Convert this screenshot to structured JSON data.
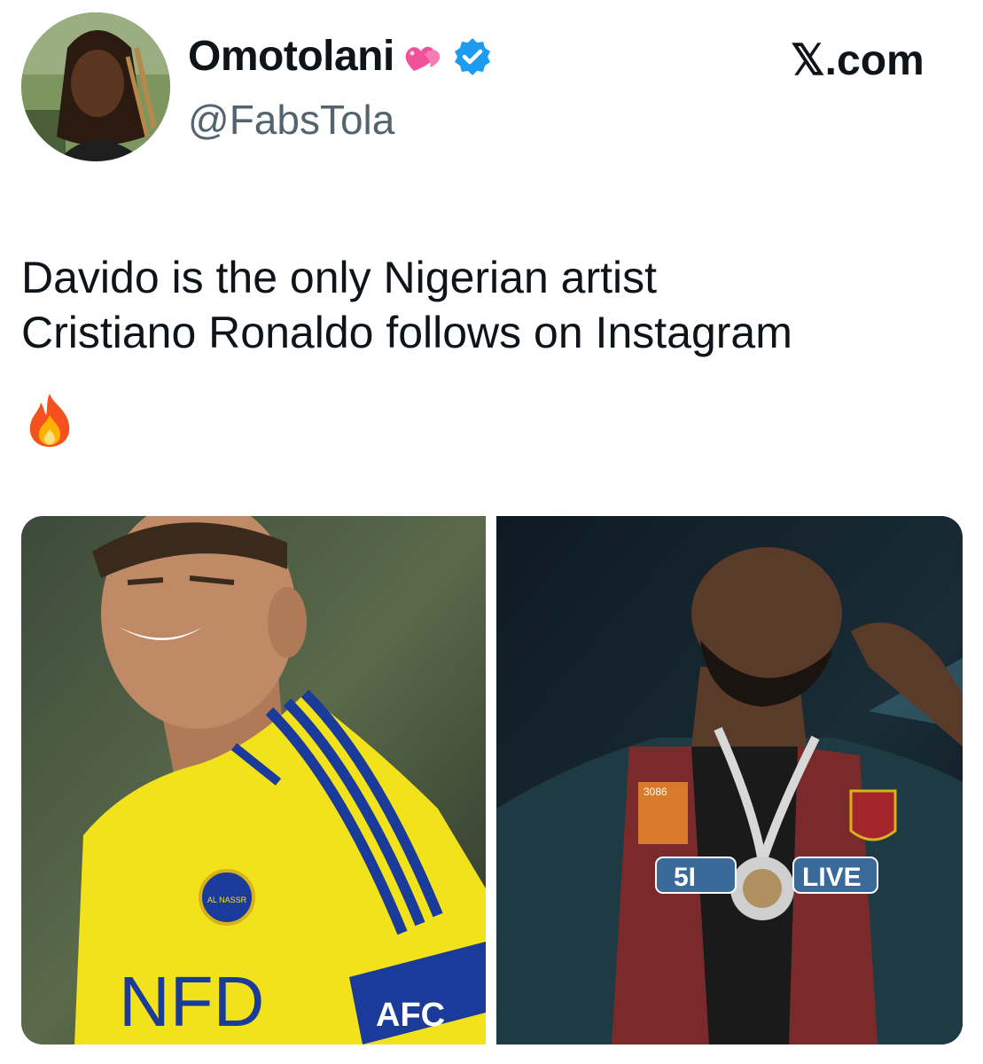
{
  "tweet": {
    "author": {
      "name": "Omotolani",
      "handle": "@FabsTola",
      "verified": true,
      "avatar_icon": "profile-photo"
    },
    "brand": "𝕏.com",
    "text_line_1": "Davido is the only Nigerian artist",
    "text_line_2": "Cristiano Ronaldo follows on Instagram",
    "emoji": "fire",
    "media": [
      {
        "subject": "footballer-photo",
        "jersey_text": "NFD",
        "armband_text": "AFC",
        "badge_text": "AL NASSR"
      },
      {
        "subject": "artist-photo",
        "patch_text": "3086",
        "chain_text_left": "5I",
        "chain_text_right": "LIVE"
      }
    ]
  },
  "colors": {
    "text": "#0f1419",
    "handle": "#536471",
    "verified": "#1d9bf0",
    "heart": "#f0519b",
    "jersey": "#f2e21b",
    "jersey_stripe": "#1b3b9a"
  }
}
